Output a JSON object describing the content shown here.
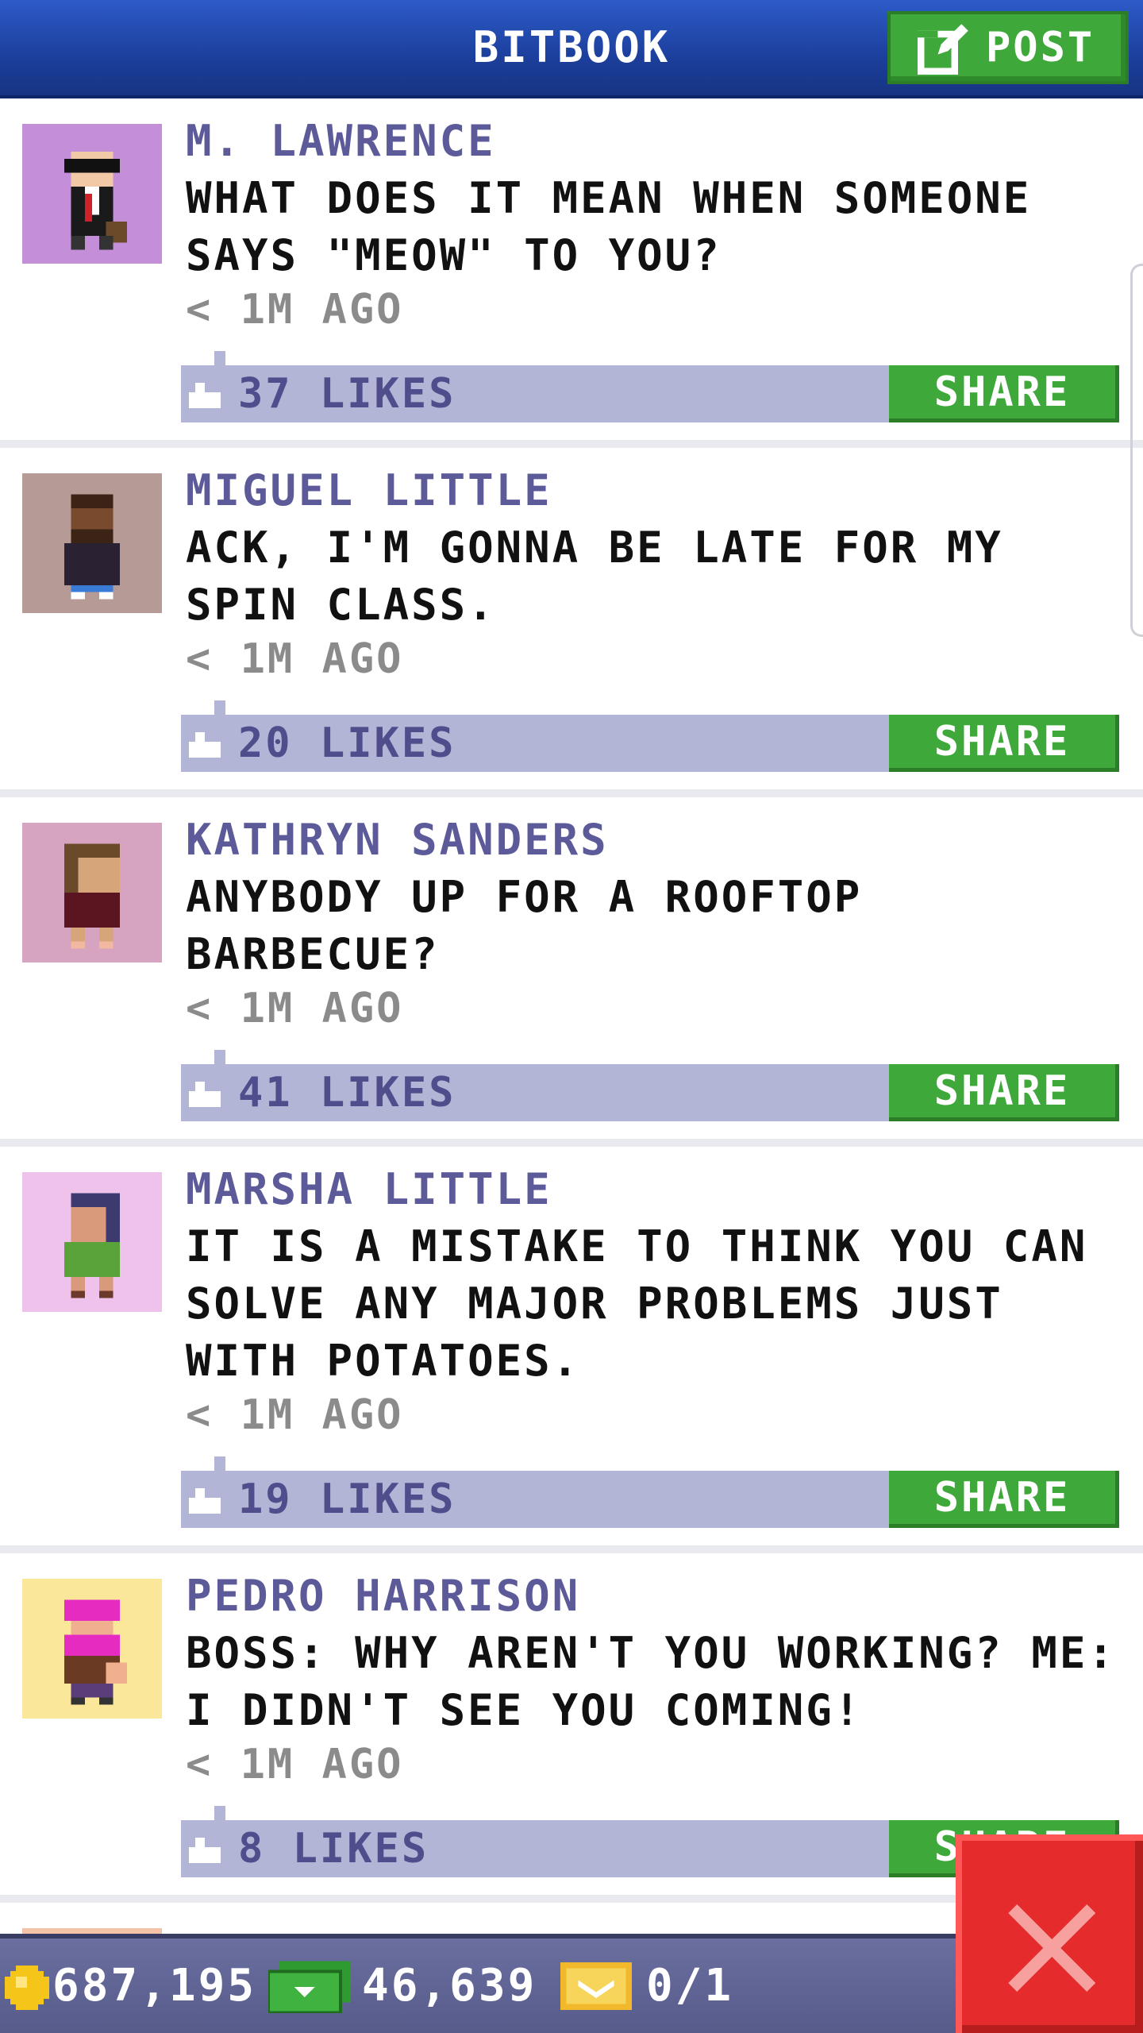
{
  "header": {
    "title": "BITBOOK",
    "post_label": "POST"
  },
  "posts": [
    {
      "author": "M. LAWRENCE",
      "message": "WHAT DOES IT MEAN WHEN SOMEONE SAYS \"MEOW\" TO YOU?",
      "time": "< 1M AGO",
      "likes": "37 LIKES",
      "share": "SHARE",
      "avatar_bg": "#c48fd8"
    },
    {
      "author": "MIGUEL LITTLE",
      "message": "ACK, I'M GONNA BE LATE FOR MY SPIN CLASS.",
      "time": "< 1M AGO",
      "likes": "20 LIKES",
      "share": "SHARE",
      "avatar_bg": "#b69a96"
    },
    {
      "author": "KATHRYN SANDERS",
      "message": "ANYBODY UP FOR A ROOFTOP BARBECUE?",
      "time": "< 1M AGO",
      "likes": "41 LIKES",
      "share": "SHARE",
      "avatar_bg": "#d6a3c1"
    },
    {
      "author": "MARSHA LITTLE",
      "message": "IT IS A MISTAKE TO THINK YOU CAN SOLVE ANY MAJOR PROBLEMS JUST WITH POTATOES.",
      "time": "< 1M AGO",
      "likes": "19 LIKES",
      "share": "SHARE",
      "avatar_bg": "#efc2ec"
    },
    {
      "author": "PEDRO HARRISON",
      "message": "BOSS: WHY AREN'T YOU WORKING? ME: I DIDN'T SEE YOU COMING!",
      "time": "< 1M AGO",
      "likes": "8 LIKES",
      "share": "SHARE",
      "avatar_bg": "#fbe79a"
    }
  ],
  "bottom_bar": {
    "coins": "687,195",
    "bux": "46,639",
    "tickets": "0/1"
  },
  "colors": {
    "header": "#1c3f9c",
    "green": "#3fa83a",
    "likes_bar": "#b3b5d6",
    "author": "#5c5a98",
    "close": "#e52b2b"
  },
  "icons": {
    "post": "edit-icon",
    "like": "thumbs-up-icon",
    "coin": "coin-icon",
    "bux": "bux-icon",
    "ticket": "ticket-icon",
    "close": "close-icon"
  }
}
